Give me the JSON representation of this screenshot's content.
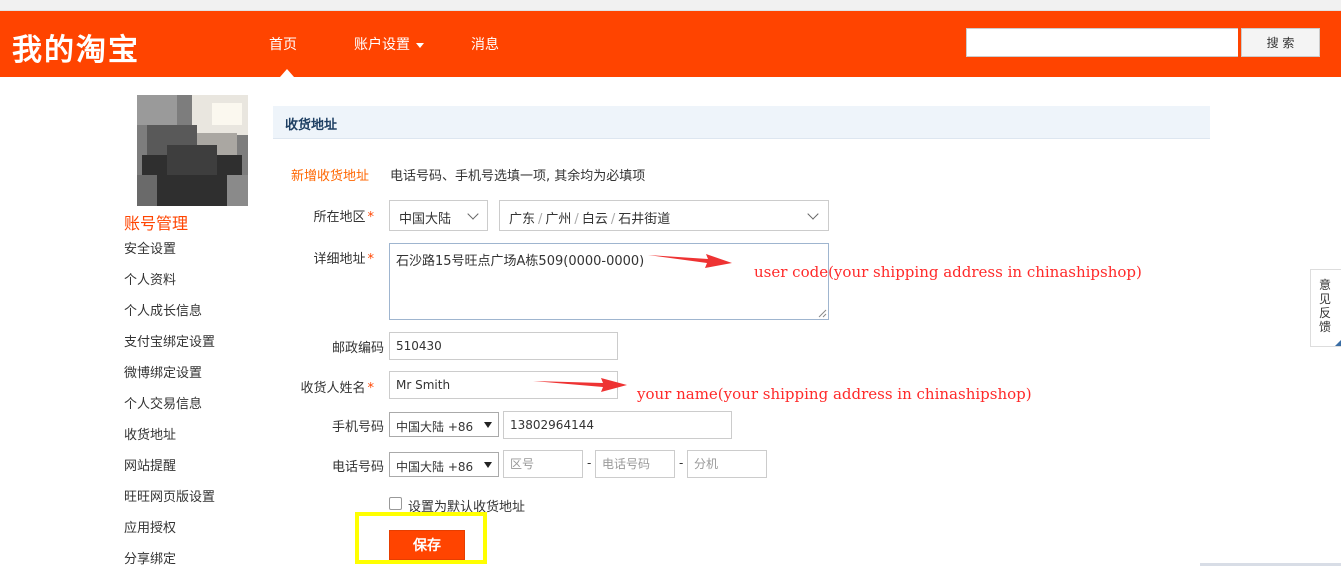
{
  "header": {
    "logo": "我的淘宝",
    "nav": {
      "home": "首页",
      "account_settings": "账户设置",
      "messages": "消息"
    },
    "search": {
      "value": "",
      "button_label": "搜 索"
    }
  },
  "sidebar": {
    "title": "账号管理",
    "items": [
      {
        "label": "安全设置"
      },
      {
        "label": "个人资料"
      },
      {
        "label": "个人成长信息"
      },
      {
        "label": "支付宝绑定设置"
      },
      {
        "label": "微博绑定设置"
      },
      {
        "label": "个人交易信息"
      },
      {
        "label": "收货地址"
      },
      {
        "label": "网站提醒"
      },
      {
        "label": "旺旺网页版设置"
      },
      {
        "label": "应用授权"
      },
      {
        "label": "分享绑定"
      }
    ]
  },
  "main": {
    "panel_title": "收货地址",
    "form_title": "新增收货地址",
    "form_note": "电话号码、手机号选填一项, 其余均为必填项",
    "region": {
      "label": "所在地区",
      "country": "中国大陆",
      "province": "广东",
      "city": "广州",
      "district": "白云",
      "street": "石井街道"
    },
    "detail_address": {
      "label": "详细地址",
      "value": "石沙路15号旺点广场A栋509(0000-0000)"
    },
    "postcode": {
      "label": "邮政编码",
      "value": "510430"
    },
    "recipient": {
      "label": "收货人姓名",
      "value": "Mr Smith"
    },
    "mobile": {
      "label": "手机号码",
      "country_code": "中国大陆 +86",
      "value": "13802964144"
    },
    "phone": {
      "label": "电话号码",
      "country_code": "中国大陆 +86",
      "area_placeholder": "区号",
      "number_placeholder": "电话号码",
      "ext_placeholder": "分机",
      "separator": "-"
    },
    "default_checkbox": {
      "label": "设置为默认收货地址",
      "checked": false
    },
    "save_label": "保存",
    "required_mark": "*"
  },
  "annotations": {
    "user_code": "user code(your shipping address in chinashipshop)",
    "your_name": "your name(your shipping address in chinashipshop)"
  },
  "feedback": {
    "label": "意见反馈"
  },
  "colors": {
    "brand": "#ff4400",
    "annotation": "#ff2a2a",
    "highlight": "#ffff00",
    "panel_header": "#eef4fa"
  }
}
